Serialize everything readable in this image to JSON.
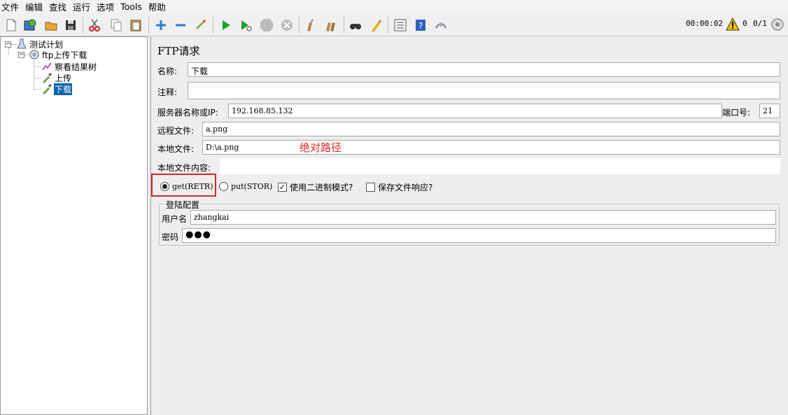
{
  "menu": [
    "文件",
    "编辑",
    "查找",
    "运行",
    "选项",
    "Tools",
    "帮助"
  ],
  "toolbar": {
    "timer": "00:00:02",
    "warnings": "0",
    "threads": "0/1",
    "icons": [
      "new-icon",
      "templates-icon",
      "open-icon",
      "save-icon",
      "cut-icon",
      "copy-icon",
      "paste-icon",
      "expand-icon",
      "collapse-icon",
      "toggle-icon",
      "start-icon",
      "start-no-pause-icon",
      "stop-icon",
      "shutdown-icon",
      "clear-icon",
      "clear-all-icon",
      "search-icon",
      "reset-search-icon",
      "function-helper-icon",
      "help-icon",
      "remote-icon"
    ]
  },
  "tree": {
    "root": "测试计划",
    "thread_group": "ftp上传下载",
    "children": [
      "察看结果树",
      "上传",
      "下载"
    ],
    "selected": "下载"
  },
  "form": {
    "title": "FTP请求",
    "name_label": "名称:",
    "name_value": "下载",
    "comment_label": "注释:",
    "comment_value": "",
    "server_label": "服务器名称或IP:",
    "server_value": "192.168.85.132",
    "port_label": "端口号:",
    "port_value": "21",
    "remote_label": "远程文件:",
    "remote_value": "a.png",
    "local_label": "本地文件:",
    "local_value": "D:\\a.png",
    "annotation": "绝对路径",
    "content_label": "本地文件内容:",
    "content_value": "",
    "get_label": "get(RETR)",
    "put_label": "put(STOR)",
    "binary_label": "使用二进制模式?",
    "binary_checked": true,
    "save_label": "保存文件响应?",
    "save_checked": false,
    "login_group": "登陆配置",
    "user_label": "用户名",
    "user_value": "zhangkai",
    "pass_label": "密码",
    "pass_value": "●●●"
  },
  "colors": {
    "selection": "#0a64ad",
    "annotation": "#e2262a"
  }
}
